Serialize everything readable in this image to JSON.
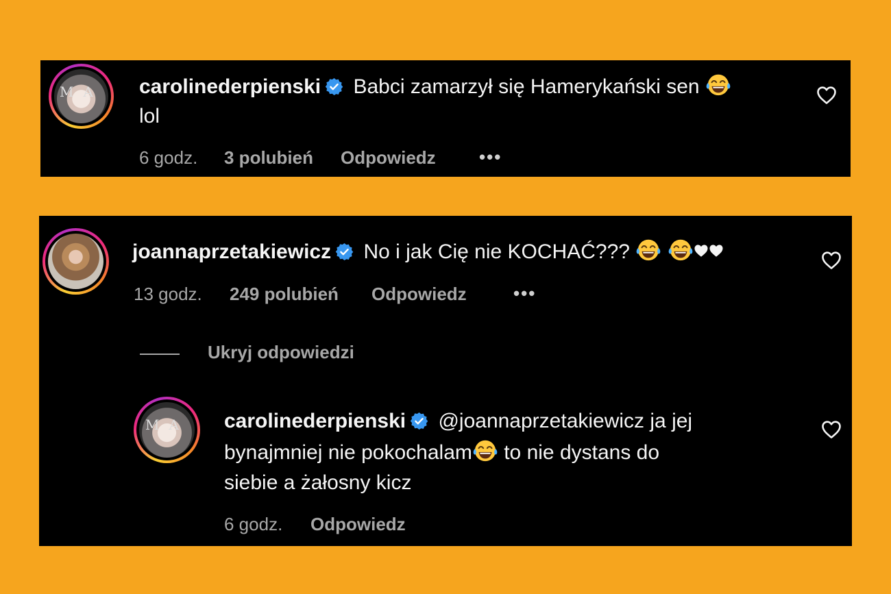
{
  "comments": [
    {
      "username": "carolinederpienski",
      "text_line1": "Babci zamarzył się Hamerykański sen",
      "text_line2": "lol",
      "time": "6 godz.",
      "likes": "3 polubień",
      "reply_label": "Odpowiedz",
      "more_label": "•••"
    },
    {
      "username": "joannaprzetakiewicz",
      "text": "No i jak Cię nie KOCHAĆ???",
      "time": "13 godz.",
      "likes": "249 polubień",
      "reply_label": "Odpowiedz",
      "more_label": "•••",
      "hide_replies_label": "Ukryj odpowiedzi",
      "reply": {
        "username": "carolinederpienski",
        "text_line1": "@joannaprzetakiewicz ja jej",
        "text_line2_a": "bynajmniej nie pokochalam",
        "text_line2_b": "to nie dystans do",
        "text_line3": "siebie a żałosny kicz",
        "time": "6 godz.",
        "reply_label": "Odpowiedz"
      }
    }
  ],
  "colors": {
    "background": "#f6a51e",
    "panel": "#000000",
    "text": "#f5f5f5",
    "muted": "#a8a8a8",
    "verified": "#3897f0"
  },
  "icons": [
    "verified-badge-icon",
    "heart-outline-icon",
    "tears-of-joy-emoji",
    "white-heart-emoji",
    "more-options-icon"
  ]
}
